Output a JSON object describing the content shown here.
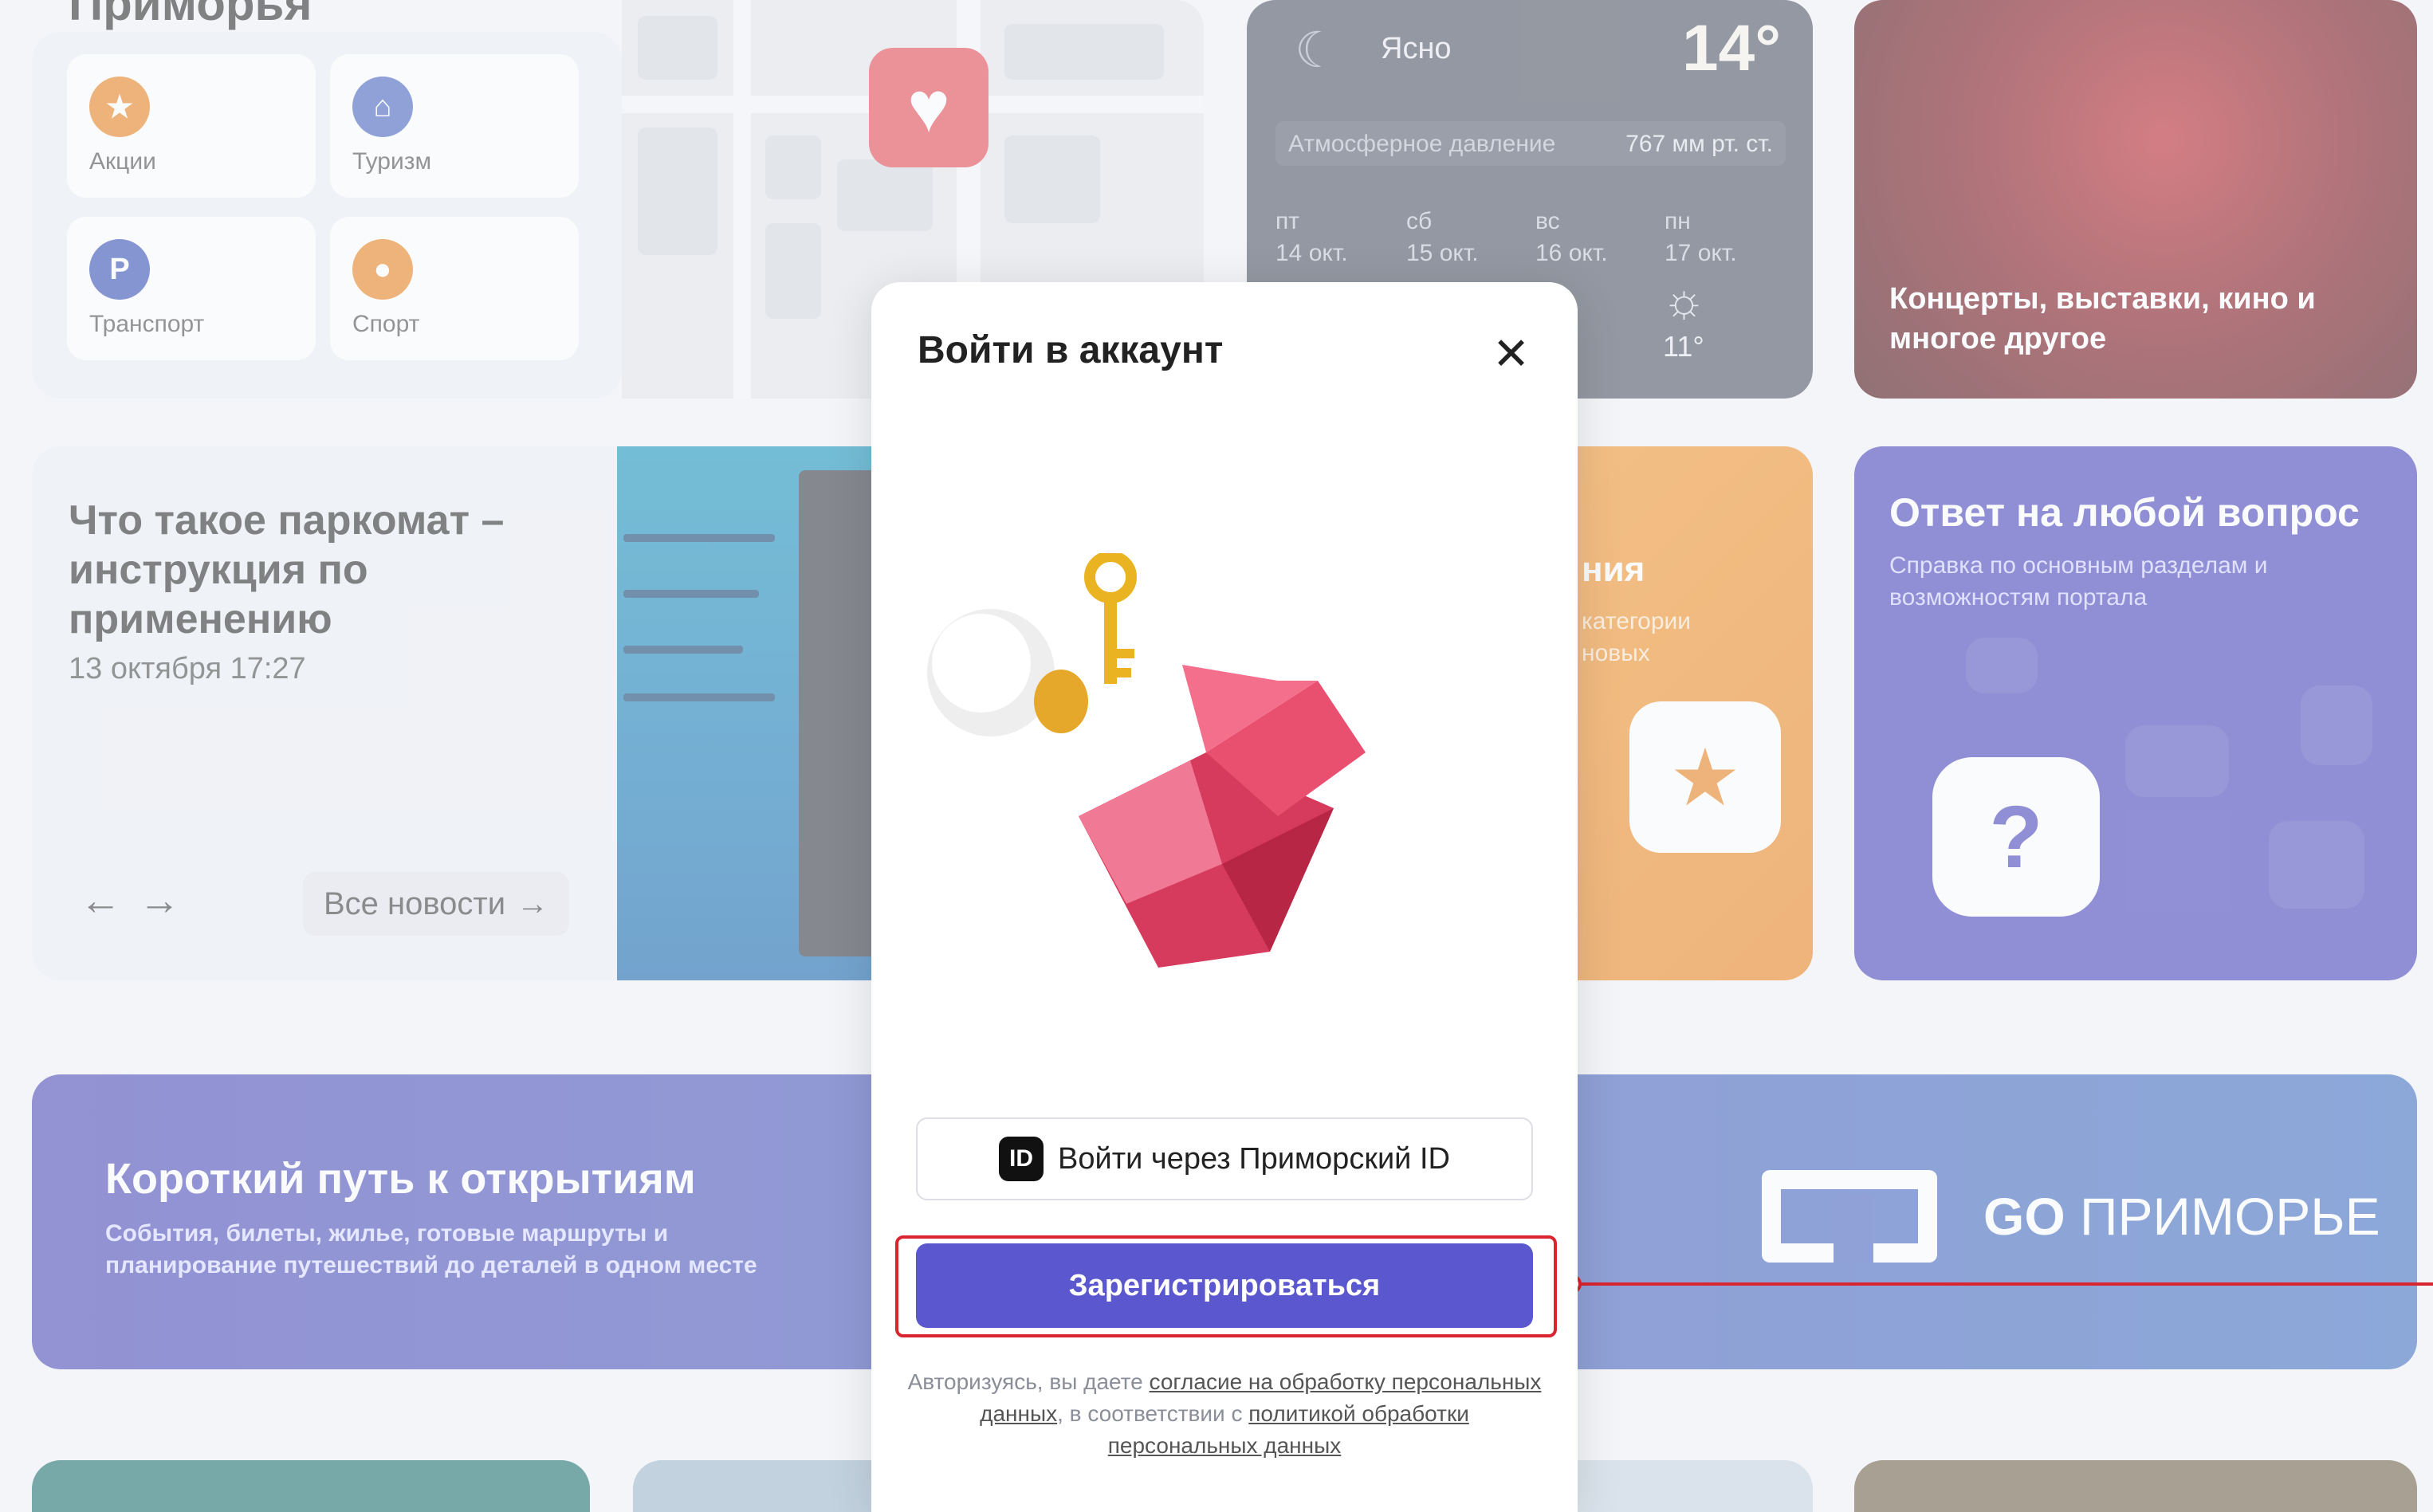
{
  "page": {
    "section_title": "Приморья"
  },
  "services": [
    {
      "label": "Акции",
      "icon": "star-icon",
      "color": "#e97d12"
    },
    {
      "label": "Туризм",
      "icon": "museum-icon",
      "color": "#3d5cbb"
    },
    {
      "label": "Транспорт",
      "icon": "parking-icon",
      "color": "#2a46b0"
    },
    {
      "label": "Спорт",
      "icon": "ball-icon",
      "color": "#e97d12"
    }
  ],
  "weather": {
    "condition": "Ясно",
    "temp": "14°",
    "pressure_label": "Атмосферное давление",
    "pressure_value": "767 мм рт. ст.",
    "days": [
      {
        "dow": "пт",
        "date": "14 окт."
      },
      {
        "dow": "сб",
        "date": "15 окт."
      },
      {
        "dow": "вс",
        "date": "16 окт."
      },
      {
        "dow": "пн",
        "date": "17 окт."
      }
    ],
    "last_low": "11°"
  },
  "events": {
    "title": "Концерты, выставки, кино и многое другое"
  },
  "news": {
    "headline": "Что такое паркомат – инструкция по применению",
    "date": "13 октября 17:27",
    "prev": "←",
    "next": "→",
    "all_label": "Все новости",
    "all_arrow": "→"
  },
  "orange_card": {
    "title": "ния",
    "subtitle": "категории\nновых"
  },
  "help_card": {
    "title": "Ответ на любой вопрос",
    "subtitle": "Справка по основным разделам и возможностям портала",
    "glyph": "?"
  },
  "banner": {
    "title": "Короткий путь к открытиям",
    "subtitle": "События, билеты, жилье, готовые маршруты и планирование путешествий до деталей в одном месте",
    "brand_go": "GO",
    "brand_name": "ПРИМОРЬЕ"
  },
  "modal": {
    "title": "Войти в аккаунт",
    "close": "✕",
    "id_badge": "ID",
    "login_id_label": "Войти через Приморский ID",
    "register_label": "Зарегистрироваться",
    "legal_prefix": "Авторизуясь, вы даете",
    "legal_link1": "согласие на обработку персональных данных",
    "legal_middle": ", в соответствии с",
    "legal_link2": "политикой обработки персональных данных"
  },
  "colors": {
    "accent": "#5b57cf",
    "highlight": "#d9252f",
    "help_bg": "#3f3bb7",
    "orange_bg": "#e97d12"
  }
}
